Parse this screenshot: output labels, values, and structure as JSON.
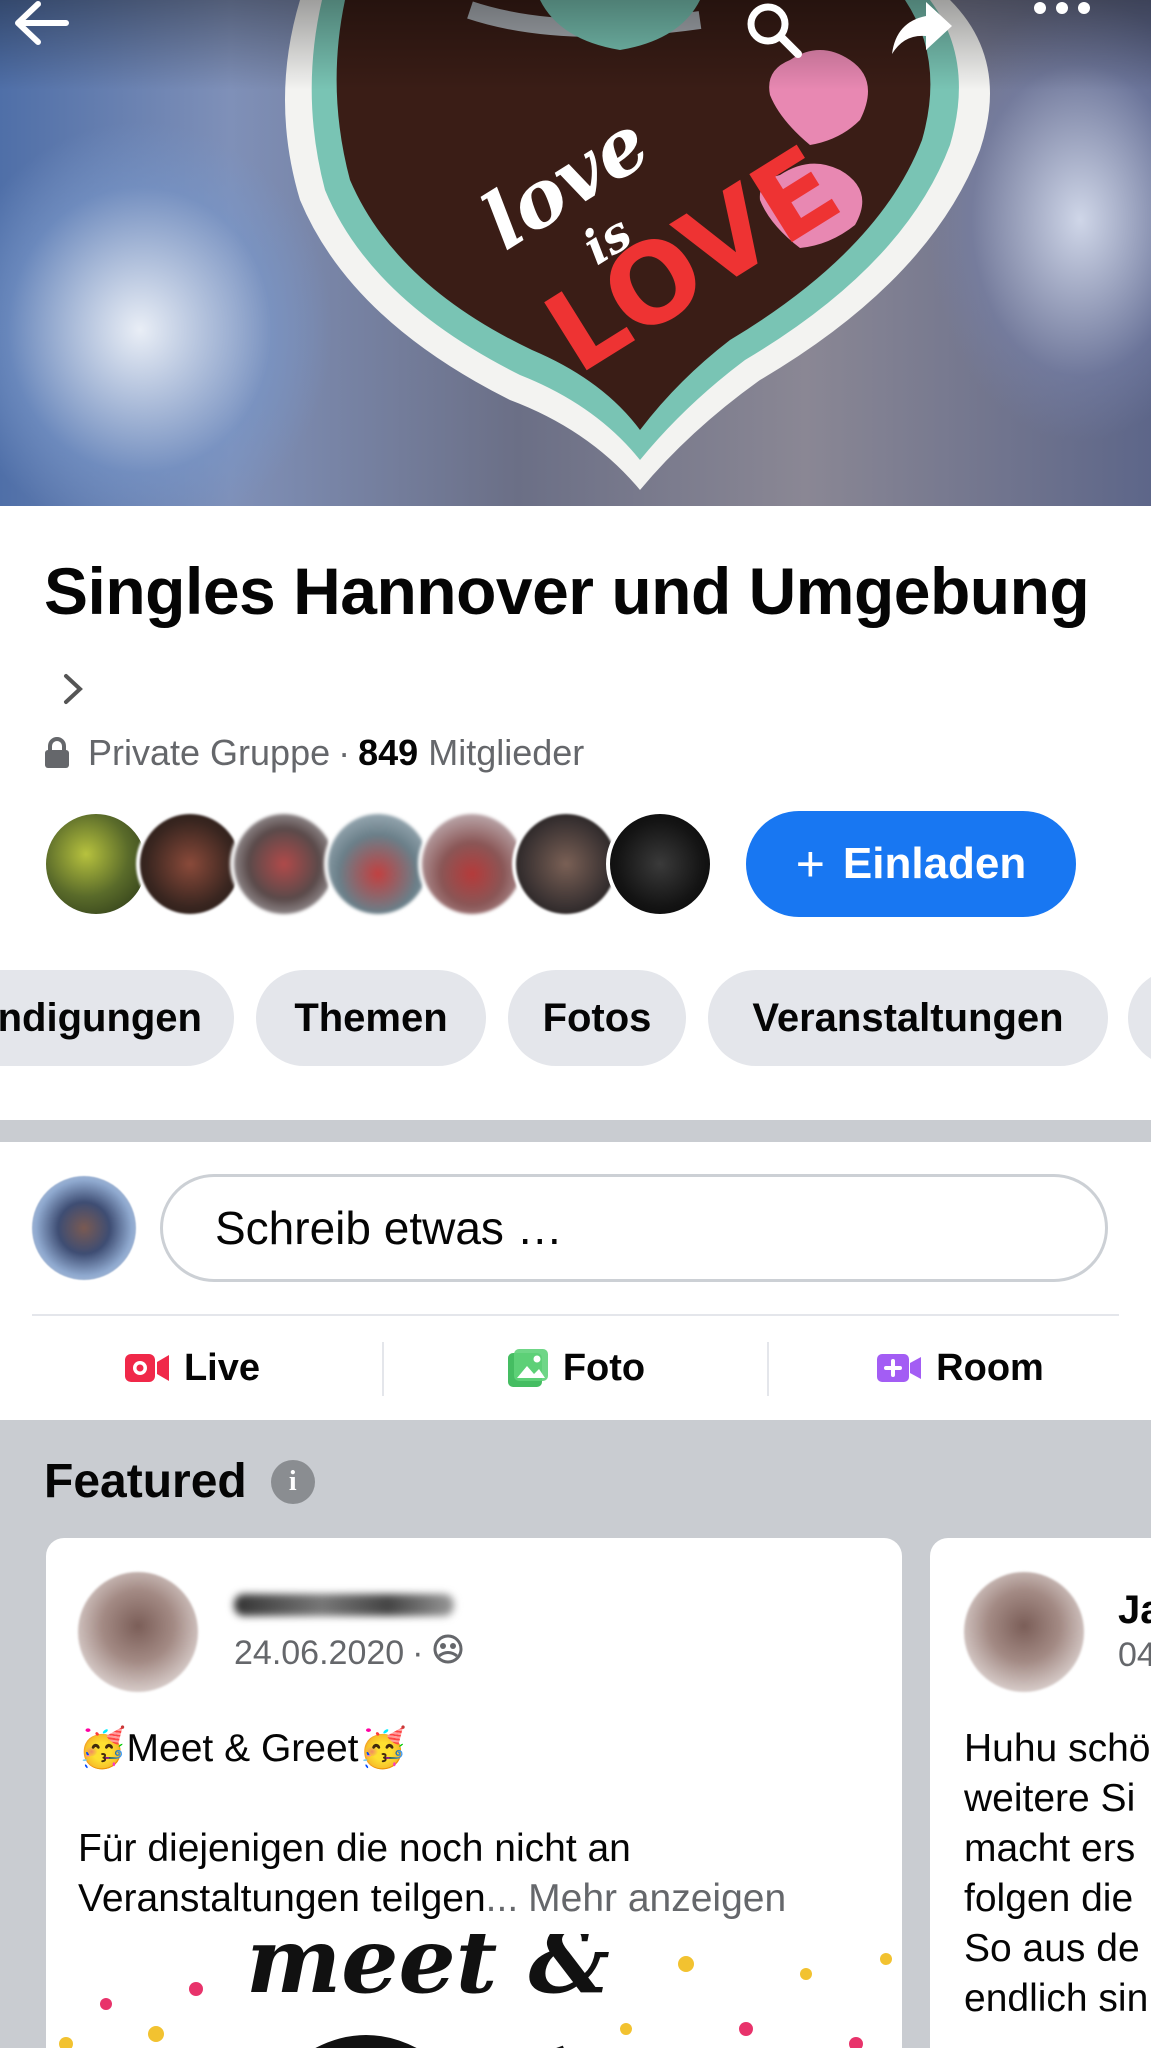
{
  "topbar": {
    "back_icon": "arrow-left-icon",
    "search_icon": "search-icon",
    "share_icon": "share-arrow-icon",
    "more_icon": "more-dots-icon"
  },
  "cover": {
    "text_line1": "love",
    "text_line2": "is",
    "text_line3": "LOVE"
  },
  "group": {
    "name": "Singles Hannover und Umgebung",
    "privacy": "Private Gruppe",
    "separator": "·",
    "member_count": "849",
    "member_label": "Mitglieder"
  },
  "invite": {
    "plus": "+",
    "label": "Einladen"
  },
  "tabs": [
    {
      "label": "ndigungen"
    },
    {
      "label": "Themen"
    },
    {
      "label": "Fotos"
    },
    {
      "label": "Veranstaltungen"
    },
    {
      "label": ""
    }
  ],
  "composer": {
    "placeholder": "Schreib etwas …"
  },
  "actions": {
    "live": "Live",
    "photo": "Foto",
    "room": "Room"
  },
  "featured": {
    "title": "Featured",
    "info": "i",
    "posts": [
      {
        "date": "24.06.2020",
        "dot": "·",
        "line1": "🥳Meet & Greet🥳",
        "line2": "Für diejenigen die noch nicht an",
        "line3": "Veranstaltungen teilgen",
        "ellipsis": "...",
        "more": "Mehr anzeigen",
        "image_text": "meet &"
      },
      {
        "name": "Ja",
        "date": "04",
        "lines": [
          "Huhu schö",
          "weitere Si",
          "macht ers",
          "folgen die",
          "So aus de",
          "endlich sin"
        ]
      }
    ]
  },
  "colors": {
    "accent": "#1877f2",
    "tab_bg": "#e4e6eb",
    "muted_text": "#65676b",
    "separator": "#c9ccd1",
    "live_red": "#f02849",
    "photo_green": "#45bd62",
    "room_purple": "#a35df4"
  }
}
